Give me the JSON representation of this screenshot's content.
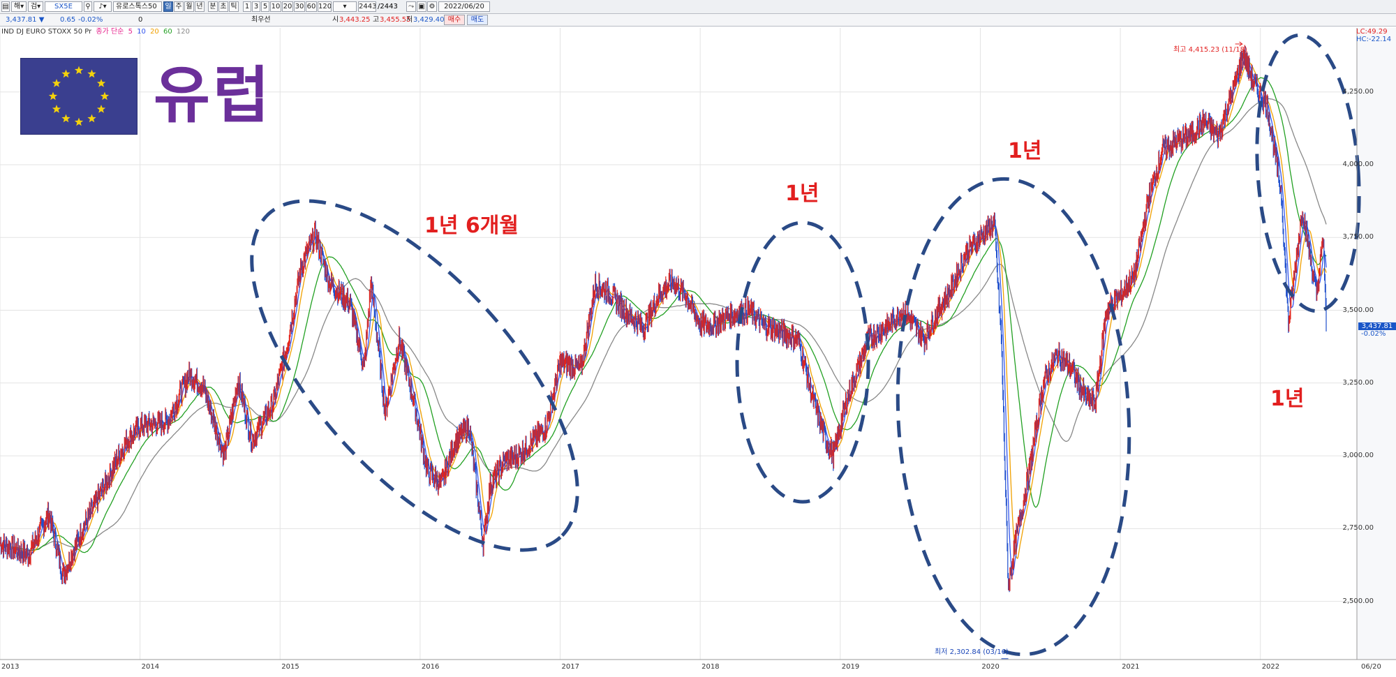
{
  "toolbar": {
    "code": "SX5E",
    "name": "유로스톡스50",
    "periods": [
      "일",
      "주",
      "월",
      "년",
      "분",
      "초",
      "틱"
    ],
    "active_period": "일",
    "intervals": [
      "1",
      "3",
      "5",
      "10",
      "20",
      "30",
      "60",
      "120"
    ],
    "count": "2443",
    "total": "/2443",
    "date": "2022/06/20"
  },
  "quote": {
    "price": "3,437.81 ▼",
    "change": "0.65",
    "change_pct": "-0.02%",
    "volume": "0",
    "prev_label": "최우선",
    "open_label": "시",
    "open": "3,443.25",
    "high_label": "고",
    "high": "3,455.55",
    "low_label": "저",
    "low": "3,429.40",
    "buy_label": "매수",
    "sell_label": "매도"
  },
  "legend": {
    "instrument": "IND DJ EURO STOXX 50 Pr",
    "ma_label": "종가 단순",
    "ma": [
      "5",
      "10",
      "20",
      "60",
      "120"
    ]
  },
  "title": "유럽",
  "annotations": {
    "a1": "1년 6개월",
    "a2": "1년",
    "a3": "1년",
    "a4": "1년"
  },
  "colors": {
    "price": "#e2231a",
    "price_down": "#1f4fcc",
    "ma5": "#e6228c",
    "ma10": "#3355ee",
    "ma20": "#f0a000",
    "ma60": "#22a022",
    "ma120": "#888888",
    "ellipse": "#2a4a86",
    "annotation": "#e21f1f"
  },
  "chart_data": {
    "type": "line",
    "x_labels": [
      "2013",
      "2014",
      "2015",
      "2016",
      "2017",
      "2018",
      "2019",
      "2020",
      "2021",
      "2022",
      "06/20"
    ],
    "y_ticks": [
      "2,500.00",
      "2,750.00",
      "3,000.00",
      "3,250.00",
      "3,500.00",
      "3,750.00",
      "4,000.00",
      "4,250.00"
    ],
    "ylim": [
      2300,
      4470
    ],
    "hc": "HC:-22.14",
    "lc": "LC:49.29",
    "high_annotation": "최고 4,415.23 (11/18)",
    "low_annotation": "최저 2,302.84 (03/16)",
    "current_price": "3,437.81",
    "current_change": "-0.02%",
    "series": [
      {
        "name": "IND DJ EURO STOXX 50 Pr",
        "x": [
          2013.0,
          2013.2,
          2013.35,
          2013.45,
          2013.6,
          2013.75,
          2013.9,
          2014.0,
          2014.2,
          2014.35,
          2014.45,
          2014.6,
          2014.7,
          2014.8,
          2014.95,
          2015.05,
          2015.15,
          2015.25,
          2015.35,
          2015.5,
          2015.6,
          2015.65,
          2015.75,
          2015.85,
          2015.95,
          2016.05,
          2016.15,
          2016.25,
          2016.35,
          2016.45,
          2016.5,
          2016.6,
          2016.7,
          2016.8,
          2016.9,
          2017.0,
          2017.15,
          2017.25,
          2017.35,
          2017.5,
          2017.6,
          2017.7,
          2017.8,
          2017.9,
          2018.0,
          2018.1,
          2018.2,
          2018.35,
          2018.45,
          2018.6,
          2018.7,
          2018.8,
          2018.9,
          2018.95,
          2019.05,
          2019.2,
          2019.35,
          2019.45,
          2019.6,
          2019.7,
          2019.8,
          2019.9,
          2020.0,
          2020.1,
          2020.15,
          2020.2,
          2020.25,
          2020.35,
          2020.45,
          2020.55,
          2020.65,
          2020.75,
          2020.82,
          2020.9,
          2021.0,
          2021.1,
          2021.2,
          2021.3,
          2021.4,
          2021.5,
          2021.6,
          2021.7,
          2021.8,
          2021.88,
          2021.95,
          2022.05,
          2022.15,
          2022.2,
          2022.3,
          2022.4,
          2022.45,
          2022.47
        ],
        "values": [
          2700,
          2660,
          2800,
          2590,
          2760,
          2900,
          3050,
          3100,
          3120,
          3280,
          3240,
          3000,
          3260,
          3050,
          3180,
          3380,
          3650,
          3760,
          3600,
          3520,
          3300,
          3600,
          3150,
          3400,
          3200,
          2950,
          2900,
          3050,
          3100,
          2700,
          2900,
          2980,
          3000,
          3050,
          3100,
          3320,
          3300,
          3590,
          3560,
          3480,
          3440,
          3550,
          3600,
          3550,
          3450,
          3450,
          3480,
          3500,
          3450,
          3420,
          3400,
          3200,
          3050,
          3000,
          3200,
          3400,
          3450,
          3500,
          3400,
          3500,
          3580,
          3700,
          3750,
          3800,
          3400,
          2550,
          2700,
          2950,
          3250,
          3350,
          3300,
          3200,
          3180,
          3500,
          3550,
          3620,
          3880,
          4050,
          4080,
          4100,
          4150,
          4100,
          4250,
          4380,
          4280,
          4200,
          3900,
          3450,
          3850,
          3550,
          3750,
          3440
        ]
      }
    ]
  }
}
